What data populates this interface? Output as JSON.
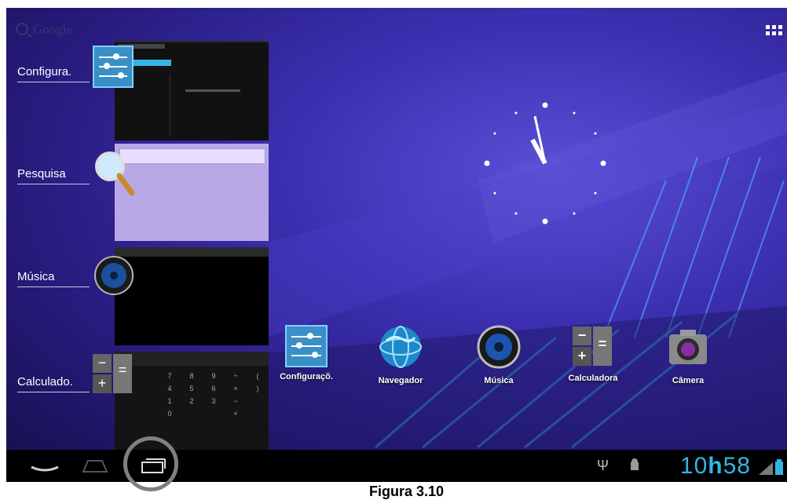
{
  "home": {
    "search_label": "Google",
    "apps_icon": "apps-grid-icon",
    "colors": {
      "accent": "#33b5e5",
      "wallpaper": "#3b2fb0"
    }
  },
  "recent_apps": [
    {
      "label": "Configura.",
      "icon": "settings-sliders-icon"
    },
    {
      "label": "Pesquisa",
      "icon": "magnifier-icon"
    },
    {
      "label": "Música",
      "icon": "speaker-icon"
    },
    {
      "label": "Calculado.",
      "icon": "calculator-icon"
    }
  ],
  "dock": [
    {
      "label": "Configuraçõ.",
      "icon": "settings-sliders-icon"
    },
    {
      "label": "Navegador",
      "icon": "globe-icon"
    },
    {
      "label": "Música",
      "icon": "speaker-icon"
    },
    {
      "label": "Calculadora",
      "icon": "calculator-icon"
    },
    {
      "label": "Câmera",
      "icon": "camera-icon"
    }
  ],
  "status_bar": {
    "clock_hour": "10",
    "clock_h": "h",
    "clock_min": "58",
    "icons": [
      "usb-icon",
      "android-debug-icon",
      "signal-icon",
      "battery-icon"
    ]
  },
  "calculator_keys": [
    "7",
    "8",
    "9",
    "÷",
    "(",
    "4",
    "5",
    "6",
    "×",
    ")",
    "1",
    "2",
    "3",
    "−",
    "",
    "0",
    "",
    "",
    "+",
    ""
  ],
  "caption": "Figura 3.10"
}
